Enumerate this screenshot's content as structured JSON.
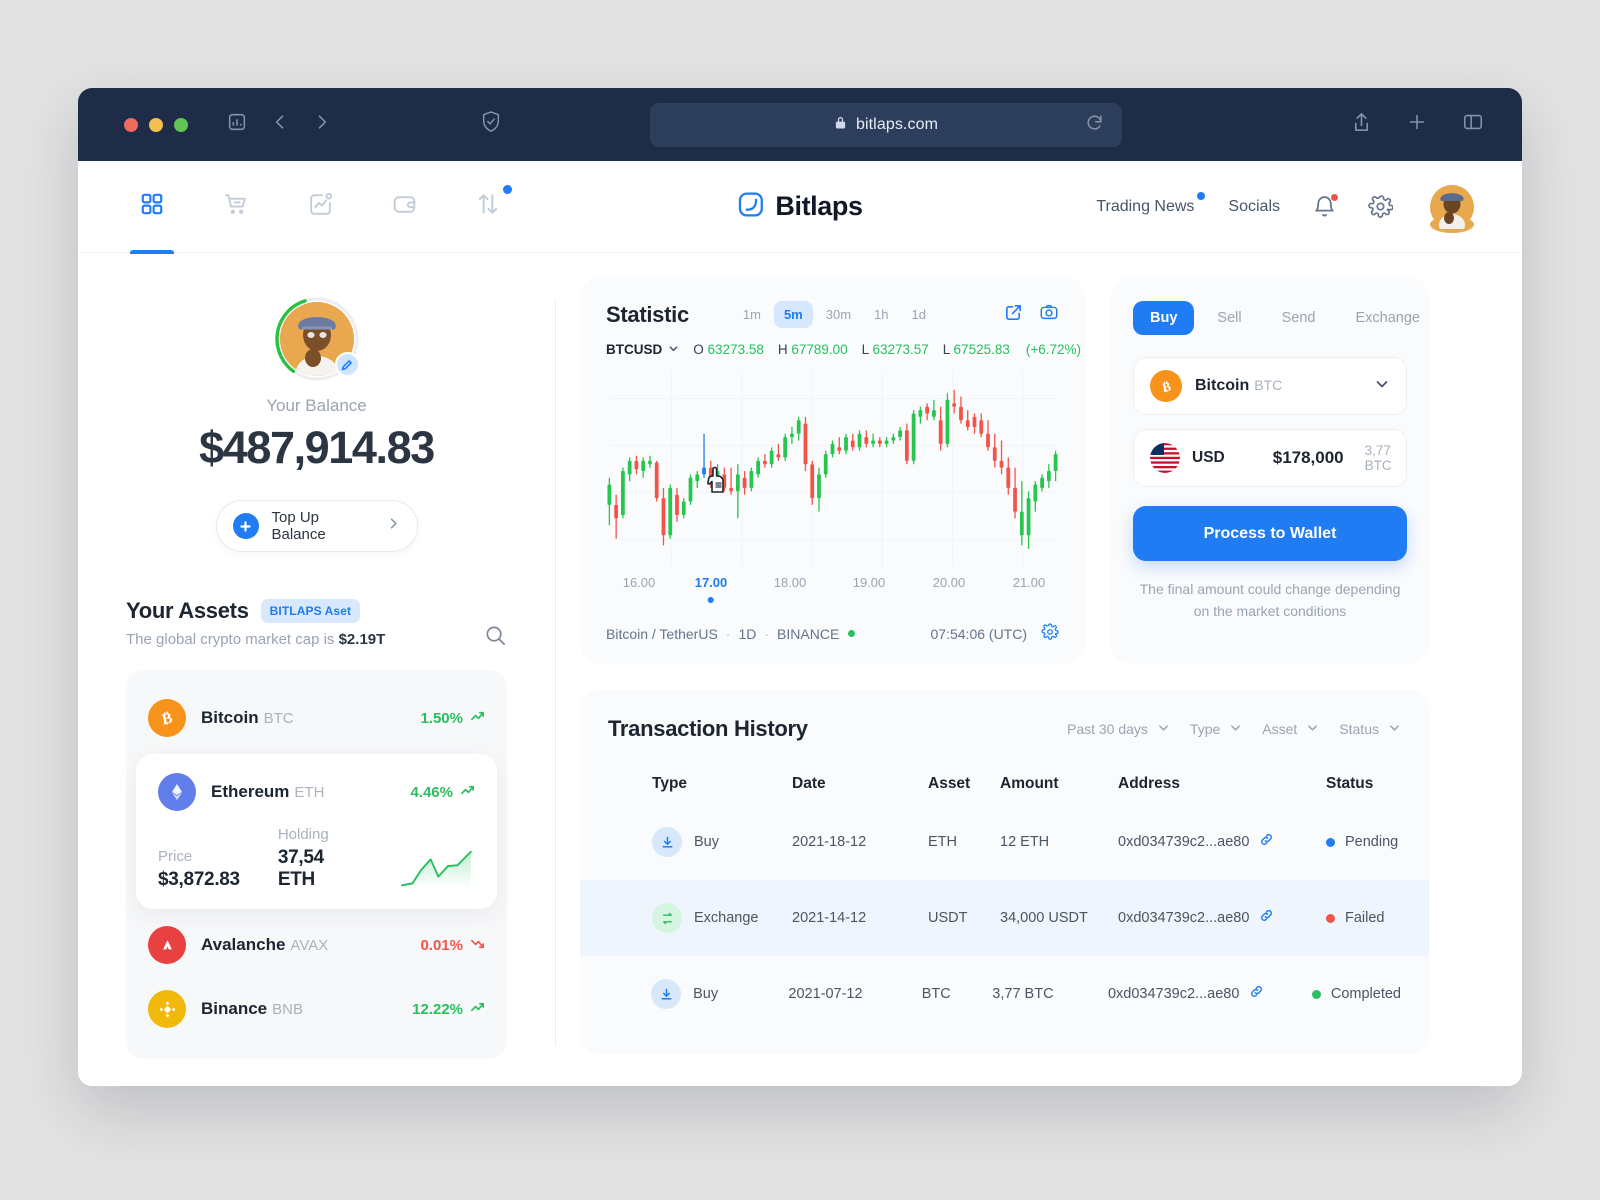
{
  "browser": {
    "url": "bitlaps.com",
    "lock_icon": "lock-icon",
    "reload_icon": "reload-icon",
    "shield_icon": "shield-icon",
    "sidebar_icon": "sidebar-icon",
    "back_icon": "back-arrow-icon",
    "forward_icon": "forward-arrow-icon",
    "share_icon": "share-icon",
    "newtab_icon": "plus-icon",
    "tabs_icon": "tab-overview-icon"
  },
  "nav": {
    "icons": [
      {
        "name": "dashboard-icon",
        "active": true,
        "badge": false
      },
      {
        "name": "cart-icon",
        "active": false,
        "badge": false
      },
      {
        "name": "analytics-icon",
        "active": false,
        "badge": false
      },
      {
        "name": "wallet-icon",
        "active": false,
        "badge": false
      },
      {
        "name": "transfer-icon",
        "active": false,
        "badge": true
      }
    ],
    "brand": "Bitlaps",
    "links": [
      {
        "label": "Trading News",
        "badge": true
      },
      {
        "label": "Socials",
        "badge": false
      }
    ],
    "bell_icon": "bell-icon",
    "settings_icon": "gear-icon",
    "avatar": "avatar"
  },
  "balance": {
    "label": "Your Balance",
    "amount": "$487,914.83",
    "topup_label": "Top Up Balance",
    "edit_icon": "edit-pencil-icon",
    "chevron_icon": "chevron-right-icon"
  },
  "assets": {
    "title": "Your Assets",
    "chip": "BITLAPS Aset",
    "subtitle_prefix": "The global crypto market cap is ",
    "market_cap": "$2.19T",
    "search_icon": "search-icon",
    "items": [
      {
        "name": "Bitcoin",
        "symbol": "BTC",
        "change": "1.50%",
        "direction": "up",
        "color": "#f7931a",
        "glyph": "₿",
        "expanded": false
      },
      {
        "name": "Ethereum",
        "symbol": "ETH",
        "change": "4.46%",
        "direction": "up",
        "color": "#627eea",
        "glyph": "Ξ",
        "expanded": true,
        "price_label": "Price",
        "price": "$3,872.83",
        "holding_label": "Holding",
        "holding": "37,54 ETH"
      },
      {
        "name": "Avalanche",
        "symbol": "AVAX",
        "change": "0.01%",
        "direction": "down",
        "color": "#e84142",
        "glyph": "▲",
        "expanded": false
      },
      {
        "name": "Binance",
        "symbol": "BNB",
        "change": "12.22%",
        "direction": "up",
        "color": "#f0b90b",
        "glyph": "◇",
        "expanded": false
      }
    ]
  },
  "statistic": {
    "title": "Statistic",
    "timeframes": [
      {
        "label": "1m",
        "active": false
      },
      {
        "label": "5m",
        "active": true
      },
      {
        "label": "30m",
        "active": false
      },
      {
        "label": "1h",
        "active": false
      },
      {
        "label": "1d",
        "active": false
      }
    ],
    "expand_icon": "external-link-icon",
    "camera_icon": "camera-icon",
    "symbol": "BTCUSD",
    "symbol_chevron": "chevron-down-icon",
    "ohlc": [
      {
        "key": "O",
        "value": "63273.58"
      },
      {
        "key": "H",
        "value": "67789.00"
      },
      {
        "key": "L",
        "value": "63273.57"
      },
      {
        "key": "L",
        "value": "67525.83"
      }
    ],
    "change": "(+6.72%)",
    "footer_pair": "Bitcoin / TetherUS",
    "footer_interval": "1D",
    "footer_exchange": "BINANCE",
    "time": "07:54:06 (UTC)",
    "settings_icon": "gear-icon",
    "cursor_icon": "pointing-hand-cursor"
  },
  "chart_data": {
    "type": "candlestick",
    "title": "BTCUSD",
    "xlabel": "",
    "ylabel": "",
    "grid": true,
    "legend": "none",
    "xticks": [
      "16.00",
      "17.00",
      "18.00",
      "19.00",
      "20.00",
      "21.00"
    ],
    "current_xtick": "17.00",
    "open": 63273.58,
    "high": 67789.0,
    "low": 63273.57,
    "close": 67525.83,
    "change_pct": 6.72,
    "colors": {
      "up": "#26c64f",
      "down": "#f3544a",
      "highlight": "#1f7cf2"
    },
    "candles": [
      {
        "o": 34,
        "h": 50,
        "l": 22,
        "c": 46,
        "d": "up"
      },
      {
        "o": 34,
        "h": 40,
        "l": 14,
        "c": 26,
        "d": "down"
      },
      {
        "o": 28,
        "h": 56,
        "l": 26,
        "c": 54,
        "d": "up"
      },
      {
        "o": 52,
        "h": 62,
        "l": 48,
        "c": 60,
        "d": "up"
      },
      {
        "o": 60,
        "h": 63,
        "l": 52,
        "c": 55,
        "d": "down"
      },
      {
        "o": 54,
        "h": 62,
        "l": 50,
        "c": 60,
        "d": "up"
      },
      {
        "o": 60,
        "h": 63,
        "l": 56,
        "c": 58,
        "d": "up"
      },
      {
        "o": 59,
        "h": 60,
        "l": 36,
        "c": 38,
        "d": "down"
      },
      {
        "o": 38,
        "h": 44,
        "l": 10,
        "c": 16,
        "d": "down"
      },
      {
        "o": 16,
        "h": 46,
        "l": 14,
        "c": 44,
        "d": "up"
      },
      {
        "o": 40,
        "h": 44,
        "l": 24,
        "c": 28,
        "d": "down"
      },
      {
        "o": 28,
        "h": 38,
        "l": 26,
        "c": 36,
        "d": "up"
      },
      {
        "o": 36,
        "h": 52,
        "l": 34,
        "c": 50,
        "d": "up"
      },
      {
        "o": 48,
        "h": 54,
        "l": 44,
        "c": 52,
        "d": "up"
      },
      {
        "o": 52,
        "h": 76,
        "l": 50,
        "c": 56,
        "d": "highlight"
      },
      {
        "o": 56,
        "h": 60,
        "l": 44,
        "c": 46,
        "d": "down"
      },
      {
        "o": 46,
        "h": 58,
        "l": 44,
        "c": 54,
        "d": "up"
      },
      {
        "o": 52,
        "h": 56,
        "l": 42,
        "c": 44,
        "d": "down"
      },
      {
        "o": 44,
        "h": 56,
        "l": 40,
        "c": 42,
        "d": "down"
      },
      {
        "o": 42,
        "h": 58,
        "l": 26,
        "c": 52,
        "d": "up"
      },
      {
        "o": 50,
        "h": 54,
        "l": 40,
        "c": 44,
        "d": "down"
      },
      {
        "o": 44,
        "h": 56,
        "l": 42,
        "c": 54,
        "d": "up"
      },
      {
        "o": 52,
        "h": 62,
        "l": 50,
        "c": 60,
        "d": "up"
      },
      {
        "o": 60,
        "h": 64,
        "l": 56,
        "c": 58,
        "d": "down"
      },
      {
        "o": 58,
        "h": 68,
        "l": 56,
        "c": 66,
        "d": "up"
      },
      {
        "o": 64,
        "h": 70,
        "l": 60,
        "c": 62,
        "d": "down"
      },
      {
        "o": 62,
        "h": 76,
        "l": 60,
        "c": 74,
        "d": "up"
      },
      {
        "o": 74,
        "h": 80,
        "l": 70,
        "c": 76,
        "d": "up"
      },
      {
        "o": 76,
        "h": 86,
        "l": 72,
        "c": 84,
        "d": "up"
      },
      {
        "o": 82,
        "h": 86,
        "l": 54,
        "c": 58,
        "d": "down"
      },
      {
        "o": 58,
        "h": 60,
        "l": 34,
        "c": 38,
        "d": "down"
      },
      {
        "o": 38,
        "h": 56,
        "l": 30,
        "c": 52,
        "d": "up"
      },
      {
        "o": 52,
        "h": 66,
        "l": 50,
        "c": 64,
        "d": "up"
      },
      {
        "o": 64,
        "h": 72,
        "l": 62,
        "c": 70,
        "d": "up"
      },
      {
        "o": 68,
        "h": 74,
        "l": 64,
        "c": 66,
        "d": "down"
      },
      {
        "o": 66,
        "h": 76,
        "l": 64,
        "c": 74,
        "d": "up"
      },
      {
        "o": 72,
        "h": 76,
        "l": 66,
        "c": 68,
        "d": "down"
      },
      {
        "o": 68,
        "h": 78,
        "l": 66,
        "c": 76,
        "d": "up"
      },
      {
        "o": 74,
        "h": 78,
        "l": 68,
        "c": 70,
        "d": "down"
      },
      {
        "o": 70,
        "h": 76,
        "l": 68,
        "c": 72,
        "d": "up"
      },
      {
        "o": 72,
        "h": 74,
        "l": 68,
        "c": 70,
        "d": "down"
      },
      {
        "o": 70,
        "h": 74,
        "l": 68,
        "c": 72,
        "d": "up"
      },
      {
        "o": 72,
        "h": 76,
        "l": 70,
        "c": 74,
        "d": "up"
      },
      {
        "o": 74,
        "h": 80,
        "l": 72,
        "c": 78,
        "d": "up"
      },
      {
        "o": 78,
        "h": 82,
        "l": 58,
        "c": 60,
        "d": "down"
      },
      {
        "o": 60,
        "h": 90,
        "l": 58,
        "c": 88,
        "d": "up"
      },
      {
        "o": 86,
        "h": 92,
        "l": 82,
        "c": 90,
        "d": "up"
      },
      {
        "o": 88,
        "h": 94,
        "l": 84,
        "c": 92,
        "d": "down"
      },
      {
        "o": 90,
        "h": 96,
        "l": 84,
        "c": 86,
        "d": "up"
      },
      {
        "o": 84,
        "h": 92,
        "l": 66,
        "c": 70,
        "d": "down"
      },
      {
        "o": 70,
        "h": 100,
        "l": 68,
        "c": 96,
        "d": "up"
      },
      {
        "o": 94,
        "h": 102,
        "l": 88,
        "c": 92,
        "d": "down"
      },
      {
        "o": 92,
        "h": 98,
        "l": 82,
        "c": 84,
        "d": "down"
      },
      {
        "o": 84,
        "h": 90,
        "l": 78,
        "c": 80,
        "d": "down"
      },
      {
        "o": 80,
        "h": 88,
        "l": 76,
        "c": 86,
        "d": "down"
      },
      {
        "o": 84,
        "h": 88,
        "l": 74,
        "c": 76,
        "d": "down"
      },
      {
        "o": 76,
        "h": 84,
        "l": 66,
        "c": 68,
        "d": "down"
      },
      {
        "o": 68,
        "h": 76,
        "l": 56,
        "c": 60,
        "d": "down"
      },
      {
        "o": 60,
        "h": 72,
        "l": 52,
        "c": 56,
        "d": "down"
      },
      {
        "o": 56,
        "h": 62,
        "l": 40,
        "c": 44,
        "d": "down"
      },
      {
        "o": 44,
        "h": 56,
        "l": 26,
        "c": 30,
        "d": "down"
      },
      {
        "o": 30,
        "h": 48,
        "l": 10,
        "c": 16,
        "d": "up"
      },
      {
        "o": 16,
        "h": 42,
        "l": 8,
        "c": 38,
        "d": "up"
      },
      {
        "o": 36,
        "h": 48,
        "l": 30,
        "c": 46,
        "d": "up"
      },
      {
        "o": 44,
        "h": 52,
        "l": 42,
        "c": 50,
        "d": "up"
      },
      {
        "o": 48,
        "h": 58,
        "l": 44,
        "c": 54,
        "d": "up"
      },
      {
        "o": 54,
        "h": 66,
        "l": 48,
        "c": 64,
        "d": "up"
      }
    ]
  },
  "trade": {
    "tabs": [
      {
        "label": "Buy",
        "active": true
      },
      {
        "label": "Sell",
        "active": false
      },
      {
        "label": "Send",
        "active": false
      },
      {
        "label": "Exchange",
        "active": false
      }
    ],
    "coin_name": "Bitcoin",
    "coin_symbol": "BTC",
    "coin_chevron": "chevron-down-icon",
    "currency": "USD",
    "flag_icon": "usa-flag-icon",
    "amount": "$178,000",
    "amount_sub": "3,77 BTC",
    "cta": "Process to Wallet",
    "disclaimer": "The final amount could change depending on the market conditions"
  },
  "transactions": {
    "title": "Transaction History",
    "filters": [
      {
        "label": "Past 30 days",
        "icon": "chevron-down-icon"
      },
      {
        "label": "Type",
        "icon": "chevron-down-icon"
      },
      {
        "label": "Asset",
        "icon": "chevron-down-icon"
      },
      {
        "label": "Status",
        "icon": "chevron-down-icon"
      }
    ],
    "columns": [
      "Type",
      "Date",
      "Asset",
      "Amount",
      "Address",
      "Status"
    ],
    "rows": [
      {
        "checked": false,
        "type": "Buy",
        "type_icon": "download-icon",
        "date": "2021-18-12",
        "asset": "ETH",
        "amount": "12 ETH",
        "address": "0xd034739c2...ae80",
        "link_icon": "link-icon",
        "status": "Pending",
        "status_color": "#1f7cf2",
        "highlight": false
      },
      {
        "checked": true,
        "type": "Exchange",
        "type_icon": "exchange-icon",
        "date": "2021-14-12",
        "asset": "USDT",
        "amount": "34,000 USDT",
        "address": "0xd034739c2...ae80",
        "link_icon": "link-icon",
        "status": "Failed",
        "status_color": "#f3544a",
        "highlight": true
      },
      {
        "checked": false,
        "type": "Buy",
        "type_icon": "download-icon",
        "date": "2021-07-12",
        "asset": "BTC",
        "amount": "3,77 BTC",
        "address": "0xd034739c2...ae80",
        "link_icon": "link-icon",
        "status": "Completed",
        "status_color": "#28bf5f",
        "highlight": false
      }
    ]
  },
  "colors": {
    "accent": "#1f7cf2",
    "chrome": "#1e2c47",
    "up": "#28bf5f",
    "down": "#f3544a"
  }
}
